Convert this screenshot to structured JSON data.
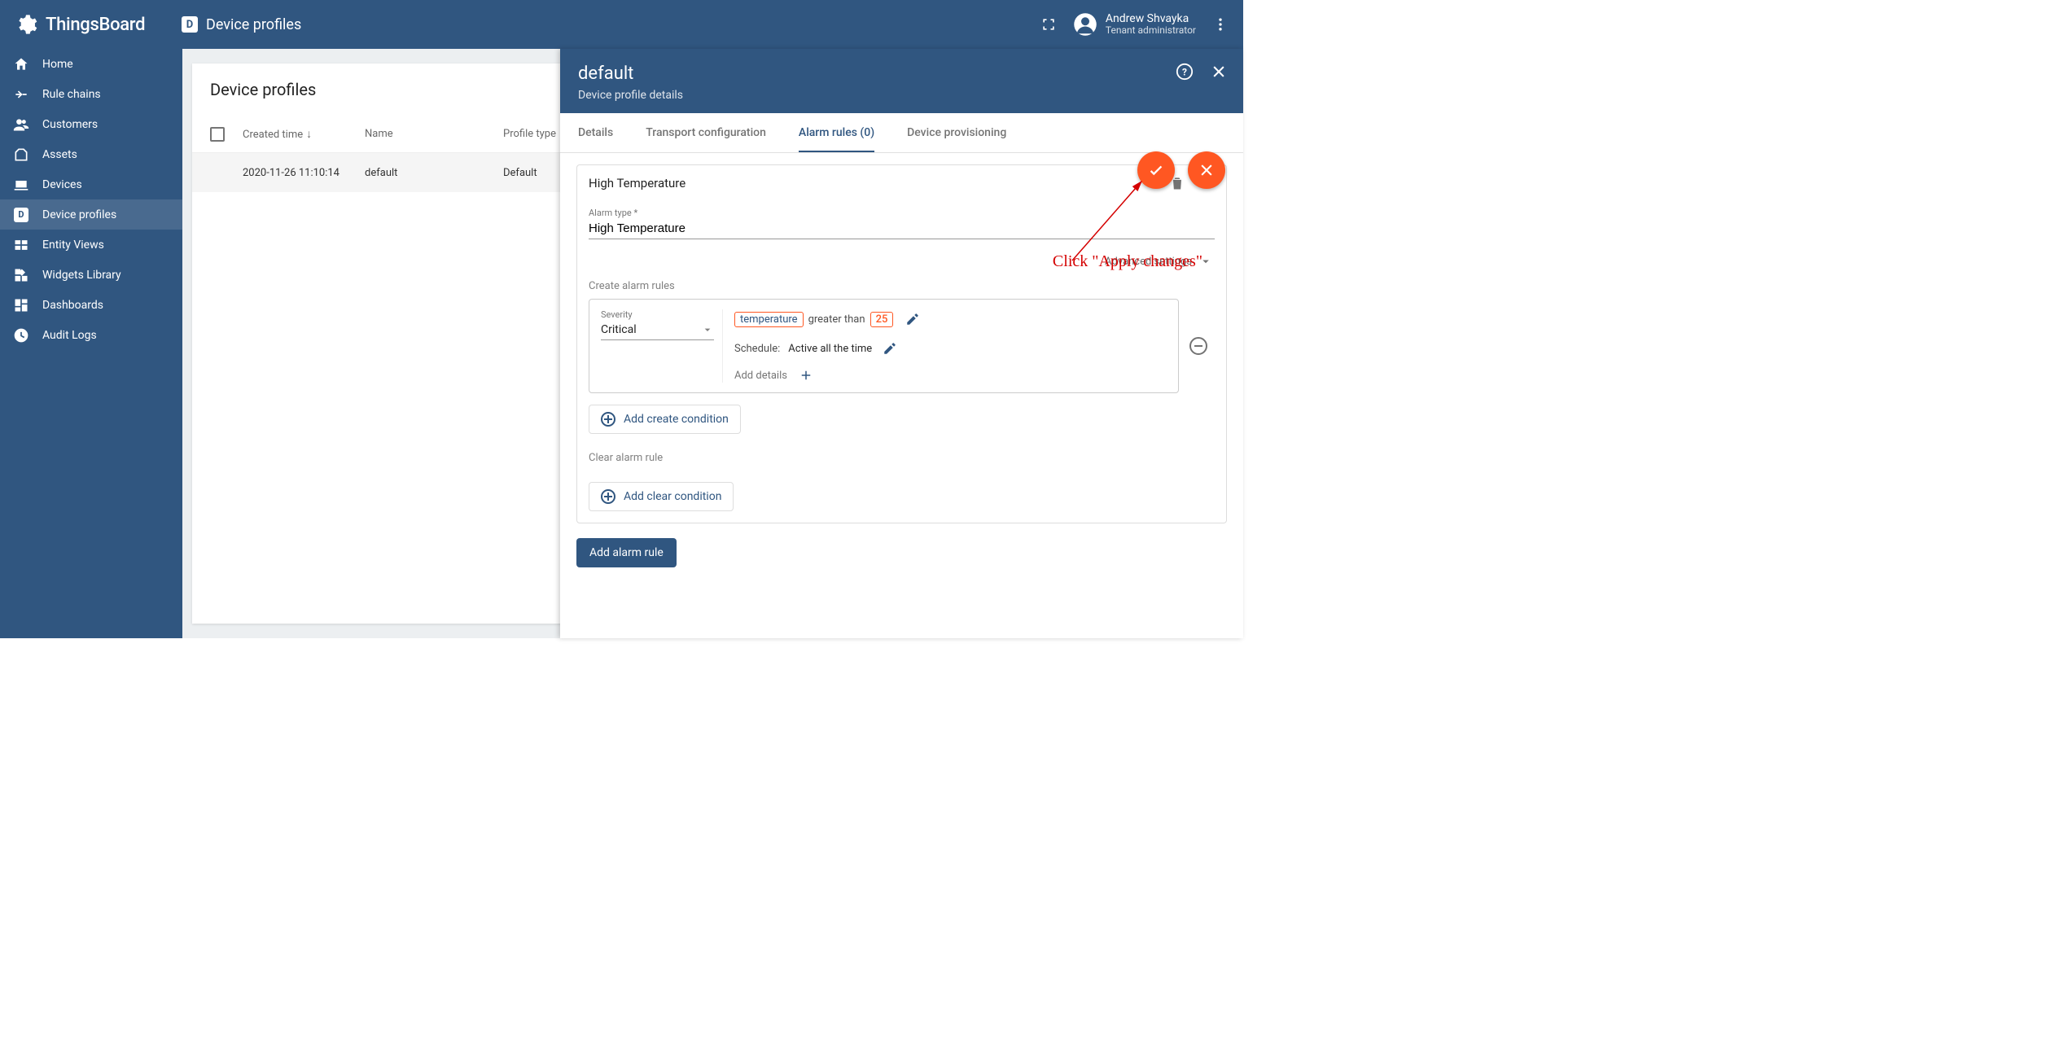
{
  "brand": "ThingsBoard",
  "page_title": "Device profiles",
  "user": {
    "name": "Andrew Shvayka",
    "role": "Tenant administrator"
  },
  "sidebar": {
    "items": [
      {
        "label": "Home"
      },
      {
        "label": "Rule chains"
      },
      {
        "label": "Customers"
      },
      {
        "label": "Assets"
      },
      {
        "label": "Devices"
      },
      {
        "label": "Device profiles"
      },
      {
        "label": "Entity Views"
      },
      {
        "label": "Widgets Library"
      },
      {
        "label": "Dashboards"
      },
      {
        "label": "Audit Logs"
      }
    ]
  },
  "list": {
    "title": "Device profiles",
    "cols": {
      "time": "Created time",
      "name": "Name",
      "type": "Profile type"
    },
    "rows": [
      {
        "time": "2020-11-26 11:10:14",
        "name": "default",
        "type": "Default"
      }
    ]
  },
  "drawer": {
    "title": "default",
    "subtitle": "Device profile details",
    "tabs": {
      "details": "Details",
      "transport": "Transport configuration",
      "alarms": "Alarm rules (0)",
      "provisioning": "Device provisioning"
    },
    "alarm": {
      "title": "High Temperature",
      "alarm_type_label": "Alarm type *",
      "alarm_type_value": "High Temperature",
      "advanced": "Advanced settings",
      "create_label": "Create alarm rules",
      "severity_label": "Severity",
      "severity_value": "Critical",
      "key": "temperature",
      "op": "greater than",
      "threshold": "25",
      "schedule_label": "Schedule:",
      "schedule_value": "Active all the time",
      "add_details": "Add details",
      "add_create_condition": "Add create condition",
      "clear_label": "Clear alarm rule",
      "add_clear_condition": "Add clear condition",
      "add_alarm_rule": "Add alarm rule"
    }
  },
  "annotation": "Click \"Apply changes\"",
  "icons": {
    "dp_square": "D"
  }
}
